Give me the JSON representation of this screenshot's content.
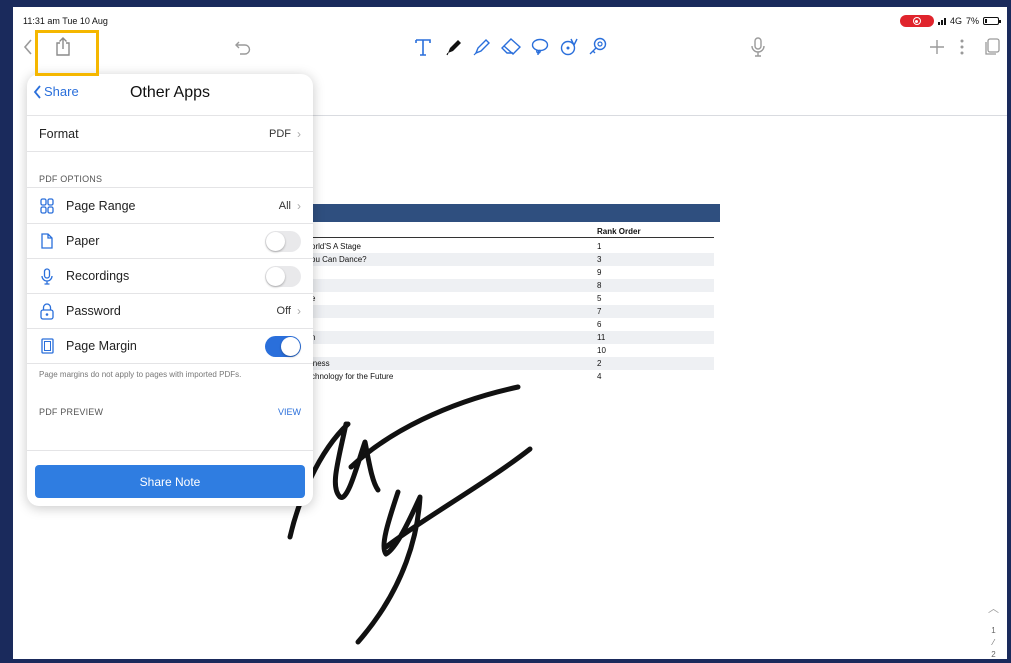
{
  "status_bar": {
    "time_date": "11:31 am  Tue 10 Aug",
    "network": "4G",
    "battery": "7%"
  },
  "popover": {
    "back_label": "Share",
    "title": "Other Apps",
    "format": {
      "label": "Format",
      "value": "PDF"
    },
    "pdf_options_label": "PDF OPTIONS",
    "page_range": {
      "label": "Page Range",
      "value": "All"
    },
    "paper": {
      "label": "Paper",
      "on": false
    },
    "recordings": {
      "label": "Recordings",
      "on": false
    },
    "password": {
      "label": "Password",
      "value": "Off"
    },
    "page_margin": {
      "label": "Page Margin",
      "on": true
    },
    "margin_note": "Page margins do not apply to pages with imported PDFs.",
    "pdf_preview_label": "PDF PREVIEW",
    "view_label": "VIEW",
    "share_button": "Share Note"
  },
  "table": {
    "column_header": "Rank Order",
    "rows": [
      {
        "name": "orld'S A Stage",
        "rank": "1"
      },
      {
        "name": "ou Can Dance?",
        "rank": "3"
      },
      {
        "name": "",
        "rank": "9"
      },
      {
        "name": "",
        "rank": "8"
      },
      {
        "name": "e",
        "rank": "5"
      },
      {
        "name": "",
        "rank": "7"
      },
      {
        "name": "",
        "rank": "6"
      },
      {
        "name": "n",
        "rank": "11"
      },
      {
        "name": "",
        "rank": "10"
      },
      {
        "name": "iness",
        "rank": "2"
      },
      {
        "name": "chnology for the Future",
        "rank": "4"
      }
    ]
  },
  "page_indicator": {
    "current": "1",
    "total": "2"
  }
}
